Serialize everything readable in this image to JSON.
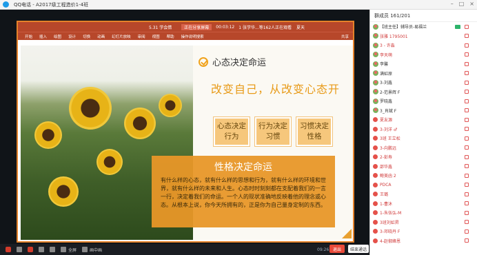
{
  "window": {
    "title": "QQ电话 - A2017级工程造价1-4班"
  },
  "ppt": {
    "title": "5.31 学会情",
    "share_label": "正在分享屏幕",
    "timer": "00:03:12",
    "viewers": "1 张学华...等162人正在观看",
    "user": "夏天",
    "share_right": "共享",
    "ribbon": [
      "开始",
      "插入",
      "绘图",
      "设计",
      "切换",
      "动画",
      "幻灯片放映",
      "审阅",
      "视图",
      "帮助",
      "操作说明搜索"
    ]
  },
  "slide": {
    "heading": "心态决定命运",
    "subtitle": "改变自己，从改变心态开",
    "boxes": [
      "心态决定行为",
      "行为决定习惯",
      "习惯决定性格"
    ],
    "panel_title": "性格决定命运",
    "panel_body": "有什么样的心态，就有什么样的思想和行为，就有什么样的环境和世界，就有什么样的未来和人生。心态时时刻刻都在支配着我们的一言一行，决定着我们的命运。一个人的现状准确地反映着他的理念或心态。从根本上说，你今天所拥有的，正是你为自己量身定制的东西。"
  },
  "toolbar": {
    "fullscreen": "全屏",
    "pip": "画中画",
    "time": "09:26",
    "exit": "退出",
    "end_class": "结束通话"
  },
  "members": {
    "header": "群成员 161/201",
    "items": [
      {
        "name": "【班主任】辅导员-易福兰",
        "color": "black"
      },
      {
        "name": "张雅 1795001",
        "color": "red"
      },
      {
        "name": "3 - 许淼",
        "color": "red"
      },
      {
        "name": "李天萌",
        "color": "red"
      },
      {
        "name": "李馨",
        "color": "black"
      },
      {
        "name": "满虹原",
        "color": "black"
      },
      {
        "name": "3-刘鑫",
        "color": "black"
      },
      {
        "name": "2-范景辉 F",
        "color": "black"
      },
      {
        "name": "罗晓鑫",
        "color": "black"
      },
      {
        "name": "3_肖斌 F",
        "color": "black"
      },
      {
        "name": "夏友源",
        "color": "red"
      },
      {
        "name": "3-刘洋 ♂",
        "color": "red"
      },
      {
        "name": "3班 王立松",
        "color": "red"
      },
      {
        "name": "3-向鹏远",
        "color": "red"
      },
      {
        "name": "2-彭寿",
        "color": "red"
      },
      {
        "name": "邵华鑫",
        "color": "red"
      },
      {
        "name": "鲍美函 2",
        "color": "red"
      },
      {
        "name": "PDCA",
        "color": "red"
      },
      {
        "name": "王璐",
        "color": "red"
      },
      {
        "name": "1-曹沐",
        "color": "red"
      },
      {
        "name": "1-朱伍弘-M",
        "color": "red"
      },
      {
        "name": "3班刘虹昇",
        "color": "red"
      },
      {
        "name": "3-邓晓丹 F",
        "color": "red"
      },
      {
        "name": "4-赵俶峰恩",
        "color": "red"
      }
    ]
  }
}
